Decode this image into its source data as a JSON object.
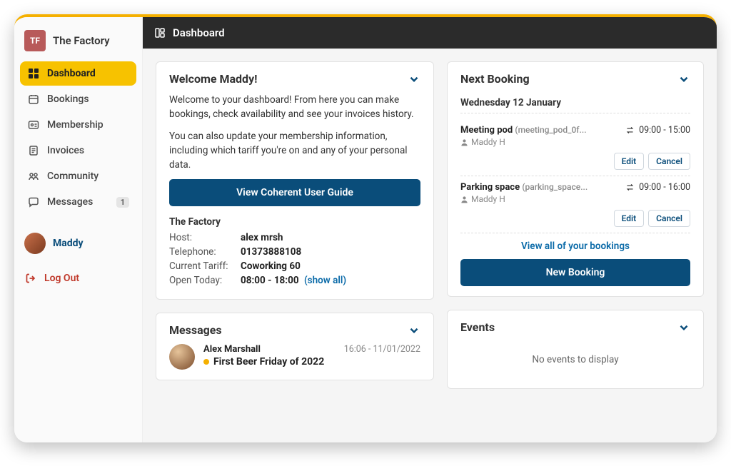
{
  "brand": {
    "initials": "TF",
    "name": "The Factory"
  },
  "header": {
    "title": "Dashboard"
  },
  "sidebar": {
    "items": [
      {
        "label": "Dashboard",
        "active": true
      },
      {
        "label": "Bookings"
      },
      {
        "label": "Membership"
      },
      {
        "label": "Invoices"
      },
      {
        "label": "Community"
      },
      {
        "label": "Messages",
        "badge": "1"
      }
    ],
    "user": {
      "name": "Maddy"
    },
    "logout": "Log Out"
  },
  "welcome": {
    "title": "Welcome Maddy!",
    "p1": "Welcome to your dashboard! From here you can make bookings, check availability and see your invoices history.",
    "p2": "You can also update your membership information, including which tariff you're on and any of your personal data.",
    "cta": "View Coherent User Guide",
    "factory_title": "The Factory",
    "host_label": "Host:",
    "host_value": "alex mrsh",
    "phone_label": "Telephone:",
    "phone_value": "01373888108",
    "tariff_label": "Current Tariff:",
    "tariff_value": "Coworking 60",
    "open_label": "Open Today:",
    "open_value": "08:00 - 18:00",
    "show_all": "(show all)"
  },
  "next_booking": {
    "title": "Next Booking",
    "date": "Wednesday 12 January",
    "items": [
      {
        "name": "Meeting pod",
        "sub": "(meeting_pod_0f...",
        "user": "Maddy H",
        "time": "09:00 - 15:00",
        "edit": "Edit",
        "cancel": "Cancel"
      },
      {
        "name": "Parking space",
        "sub": "(parking_space...",
        "user": "Maddy H",
        "time": "09:00 - 16:00",
        "edit": "Edit",
        "cancel": "Cancel"
      }
    ],
    "view_all": "View all of your bookings",
    "new_booking": "New Booking"
  },
  "events": {
    "title": "Events",
    "empty": "No events to display"
  },
  "messages": {
    "title": "Messages",
    "items": [
      {
        "sender": "Alex Marshall",
        "datetime": "16:06 - 11/01/2022",
        "subject": "First Beer Friday of 2022"
      }
    ]
  }
}
